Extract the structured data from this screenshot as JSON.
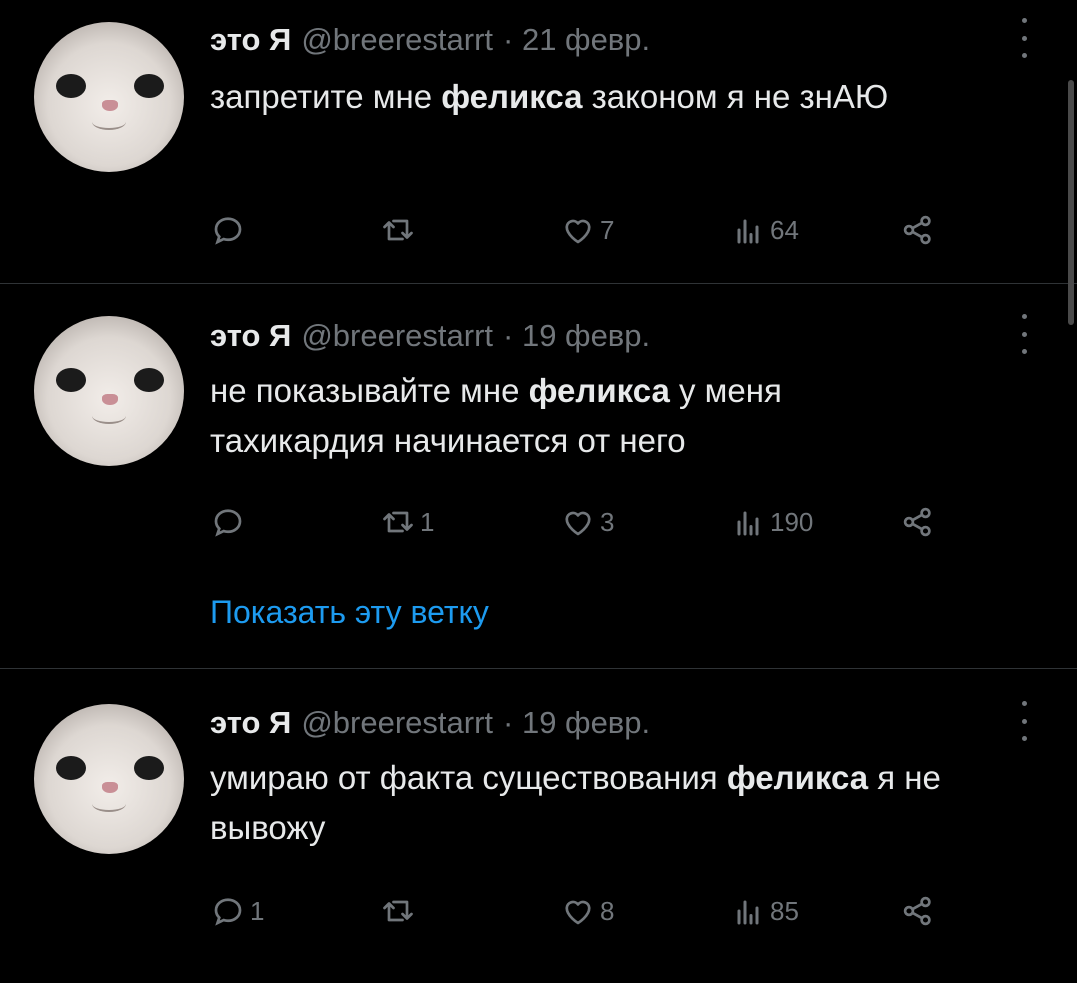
{
  "tweets": [
    {
      "author": "это Я",
      "handle": "@breerestarrt",
      "date": "· 21 февр.",
      "text_parts": [
        {
          "t": "запретите мне ",
          "b": false
        },
        {
          "t": "феликса",
          "b": true
        },
        {
          "t": " законом я не знАЮ",
          "b": false
        }
      ],
      "replies": "",
      "retweets": "",
      "likes": "7",
      "views": "64"
    },
    {
      "author": "это Я",
      "handle": "@breerestarrt",
      "date": "· 19 февр.",
      "text_parts": [
        {
          "t": "не показывайте мне ",
          "b": false
        },
        {
          "t": "феликса",
          "b": true
        },
        {
          "t": " у меня тахикардия начинается от него",
          "b": false
        }
      ],
      "replies": "",
      "retweets": "1",
      "likes": "3",
      "views": "190",
      "thread_link": "Показать эту ветку"
    },
    {
      "author": "это Я",
      "handle": "@breerestarrt",
      "date": "· 19 февр.",
      "text_parts": [
        {
          "t": "умираю от факта существования ",
          "b": false
        },
        {
          "t": "феликса",
          "b": true
        },
        {
          "t": " я не вывожу",
          "b": false
        }
      ],
      "replies": "1",
      "retweets": "",
      "likes": "8",
      "views": "85"
    }
  ],
  "icons": {
    "reply": "reply-icon",
    "retweet": "retweet-icon",
    "like": "heart-icon",
    "views": "views-icon",
    "share": "share-icon",
    "more": "more-icon"
  },
  "colors": {
    "background": "#000000",
    "text": "#e7e9ea",
    "muted": "#71767b",
    "link": "#1d9bf0",
    "divider": "#2f3336"
  }
}
